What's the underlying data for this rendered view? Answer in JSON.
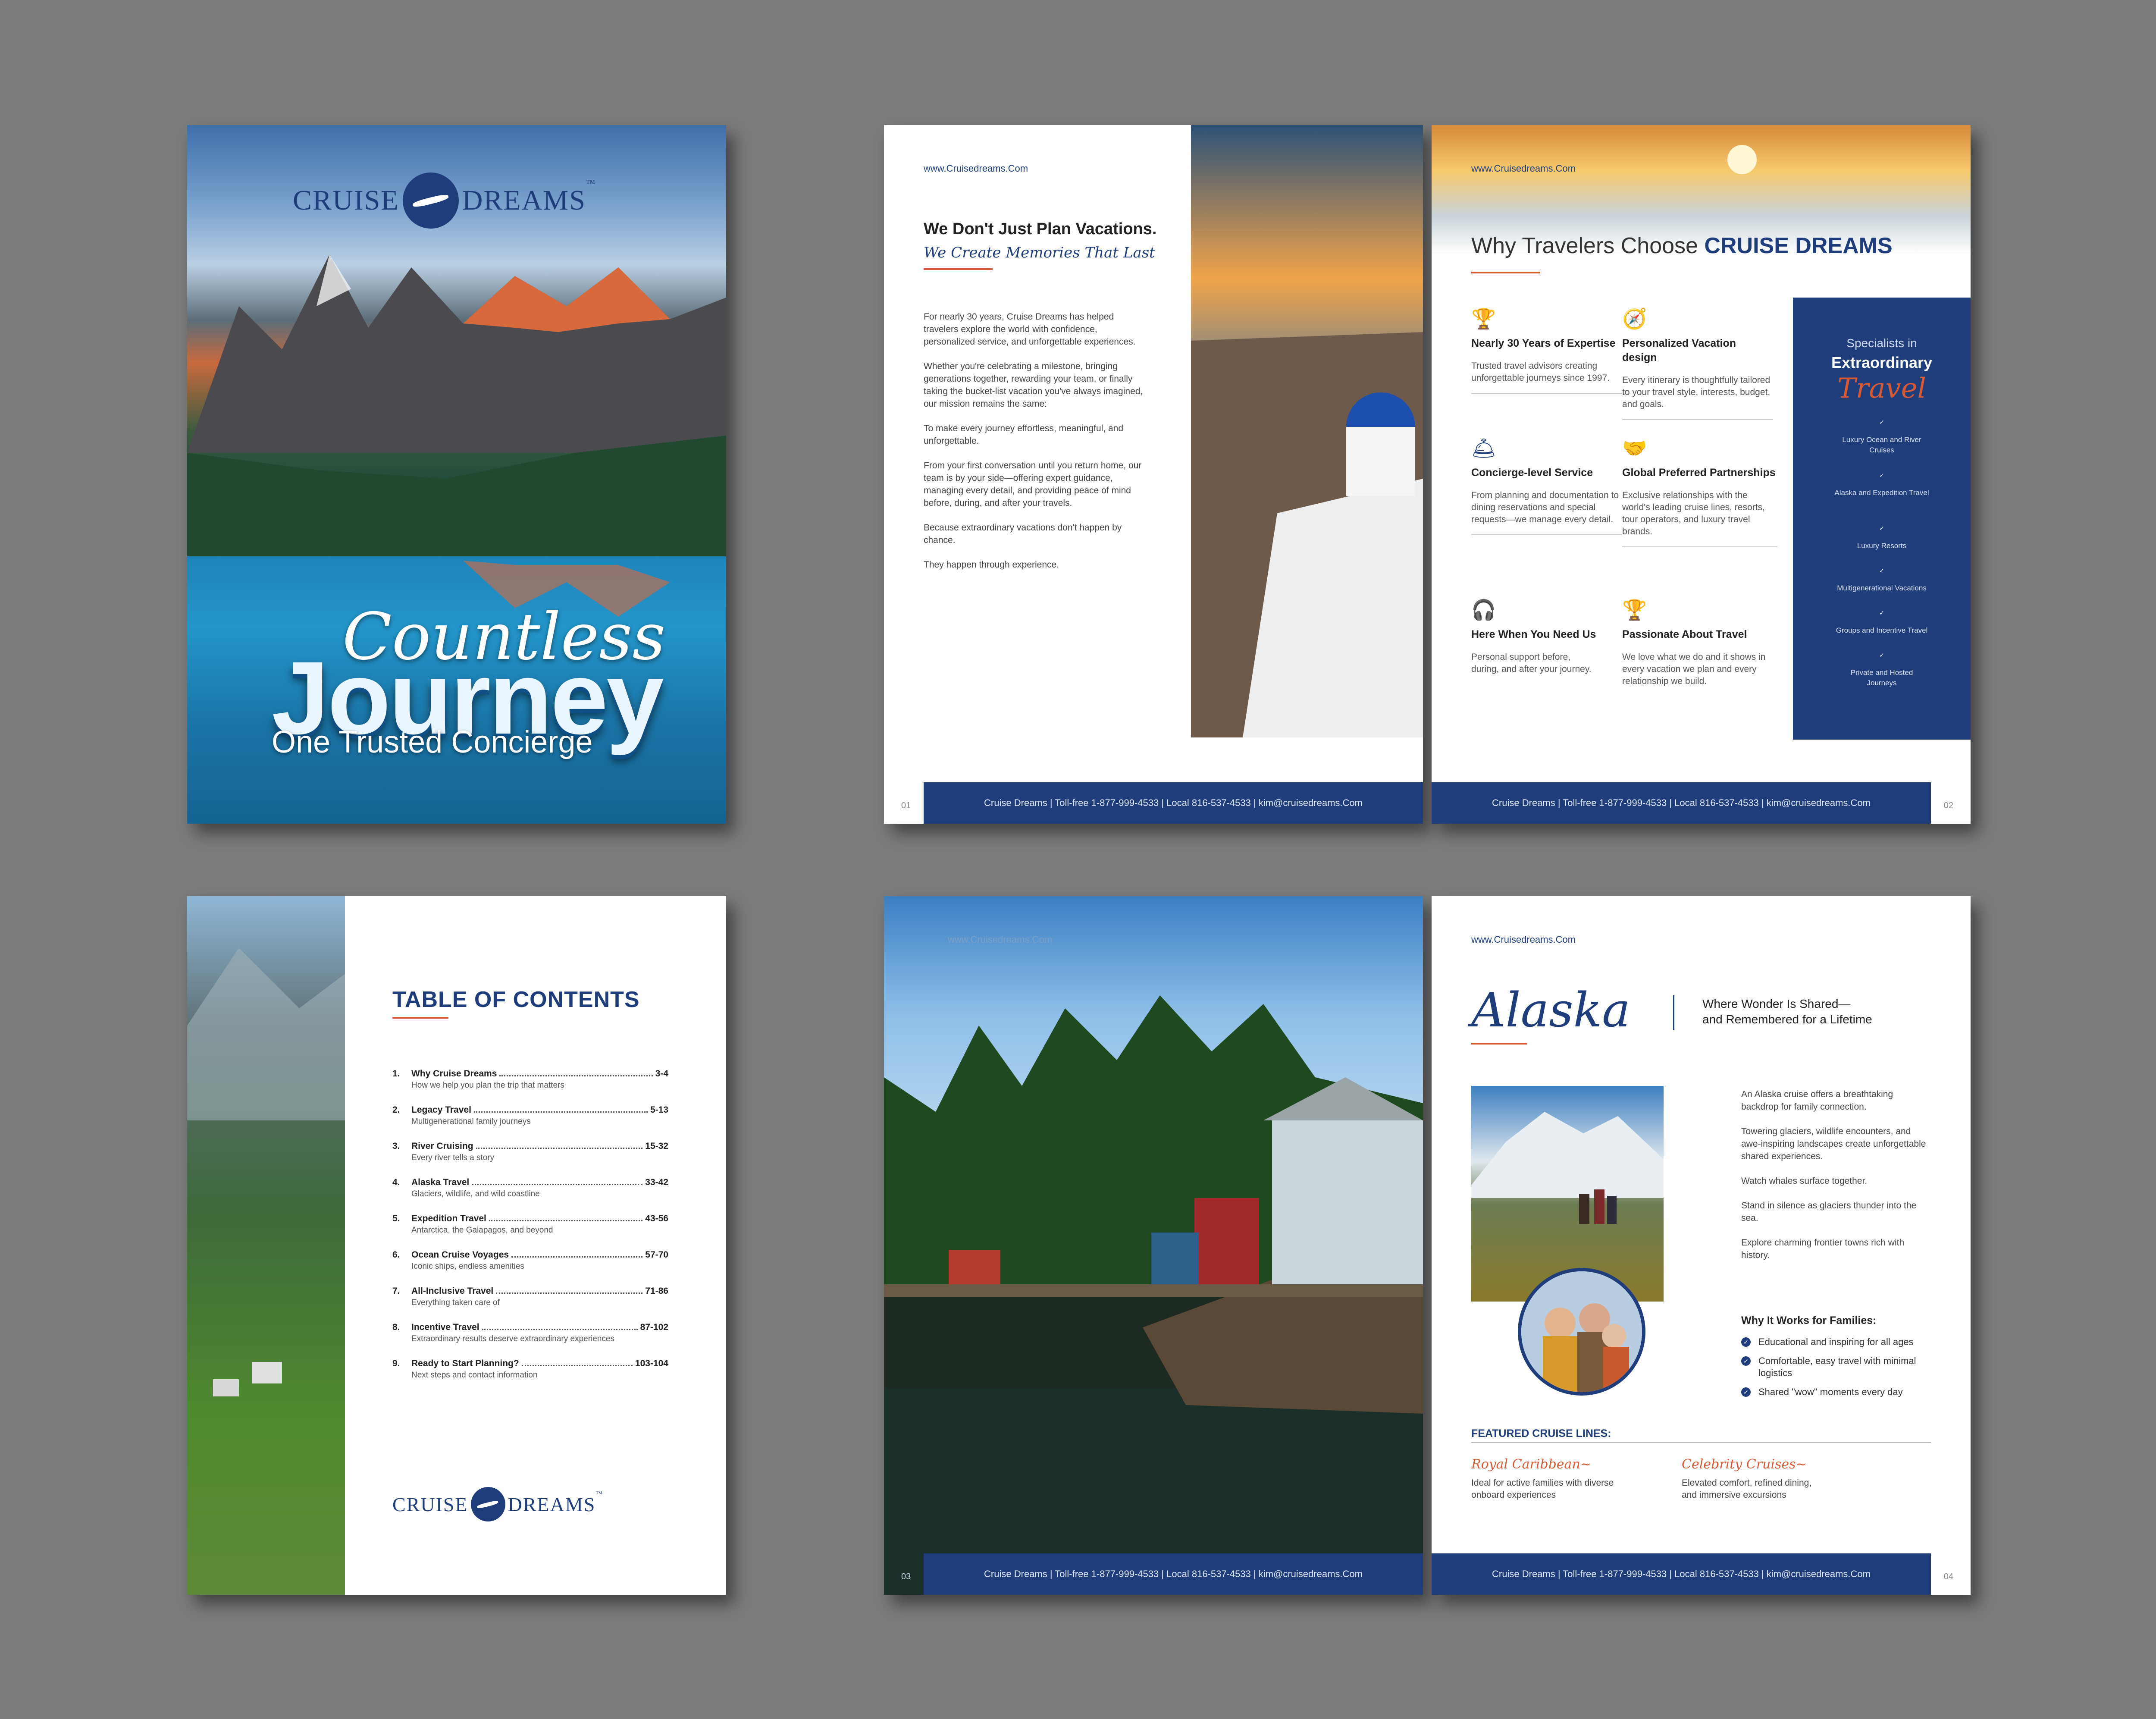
{
  "brand": {
    "name_left": "CRUISE",
    "name_right": "DREAMS",
    "tm": "™",
    "url": "www.Cruisedreams.Com"
  },
  "cover": {
    "script_title": "Countless",
    "title": "Journey",
    "subtitle": "One Trusted Concierge"
  },
  "footer_text": "Cruise Dreams | Toll-free 1-877-999-4533 | Local 816-537-4533 | kim@cruisedreams.Com",
  "page1": {
    "heading": "We Don't Just Plan Vacations.",
    "script_heading": "We Create Memories That Last",
    "paragraphs": [
      "For nearly 30 years, Cruise Dreams has helped travelers explore the world with confidence, personalized service, and unforgettable experiences.",
      "Whether you're celebrating a milestone, bringing generations together, rewarding your team, or finally taking the bucket-list vacation you've always imagined, our mission remains the same:",
      "To make every journey effortless, meaningful, and unforgettable.",
      "From your first conversation until you return home, our team is by your side—offering expert guidance, managing every detail, and providing peace of mind before, during, and after your travels.",
      "Because extraordinary vacations don't happen by chance.",
      "They happen through experience."
    ],
    "page_number": "01"
  },
  "page2": {
    "heading_plain": "Why Travelers Choose",
    "heading_bold": "CRUISE DREAMS",
    "features": [
      {
        "icon": "laurel-trophy-icon",
        "title": "Nearly 30 Years of Expertise",
        "desc": "Trusted travel advisors creating unforgettable journeys since 1997."
      },
      {
        "icon": "compass-icon",
        "title": "Personalized Vacation design",
        "desc": "Every itinerary is thoughtfully tailored to your travel style, interests, budget, and goals."
      },
      {
        "icon": "service-bell-icon",
        "title": "Concierge-level Service",
        "desc": "From planning and documentation to dining reservations and special requests—we manage every detail."
      },
      {
        "icon": "handshake-icon",
        "title": "Global Preferred Partnerships",
        "desc": "Exclusive relationships with the world's leading cruise lines, resorts, tour operators, and luxury travel brands."
      },
      {
        "icon": "headset-icon",
        "title": "Here When You Need Us",
        "desc": "Personal support before, during, and after your journey."
      },
      {
        "icon": "trophy-icon",
        "title": "Passionate About Travel",
        "desc": "We love what we do and it shows in every vacation we plan and every relationship we build."
      }
    ],
    "sidebar": {
      "line1": "Specialists in",
      "line2": "Extraordinary",
      "script": "Travel",
      "items": [
        "Luxury Ocean and River Cruises",
        "Alaska and Expedition Travel",
        "Luxury Resorts",
        "Multigenerational Vacations",
        "Groups and Incentive Travel",
        "Private and Hosted Journeys"
      ]
    },
    "page_number": "02"
  },
  "toc": {
    "title": "TABLE OF CONTENTS",
    "items": [
      {
        "num": "1.",
        "title": "Why Cruise Dreams",
        "pages": "3-4",
        "sub": "How we help you plan the trip that matters"
      },
      {
        "num": "2.",
        "title": "Legacy Travel",
        "pages": "5-13",
        "sub": "Multigenerational family journeys"
      },
      {
        "num": "3.",
        "title": "River Cruising",
        "pages": "15-32",
        "sub": "Every river tells a story"
      },
      {
        "num": "4.",
        "title": "Alaska Travel",
        "pages": "33-42",
        "sub": "Glaciers, wildlife, and wild coastline"
      },
      {
        "num": "5.",
        "title": "Expedition Travel",
        "pages": "43-56",
        "sub": "Antarctica, the Galapagos, and beyond"
      },
      {
        "num": "6.",
        "title": "Ocean Cruise Voyages",
        "pages": "57-70",
        "sub": "Iconic ships, endless amenities"
      },
      {
        "num": "7.",
        "title": "All-Inclusive Travel",
        "pages": "71-86",
        "sub": "Everything taken care of"
      },
      {
        "num": "8.",
        "title": "Incentive Travel",
        "pages": "87-102",
        "sub": "Extraordinary results deserve extraordinary experiences"
      },
      {
        "num": "9.",
        "title": "Ready to Start Planning?",
        "pages": "103-104",
        "sub": "Next steps and contact information"
      }
    ]
  },
  "page3": {
    "page_number": "03"
  },
  "page4": {
    "script_title": "Alaska",
    "tagline1": "Where Wonder Is Shared—",
    "tagline2": "and Remembered for a Lifetime",
    "paragraphs": [
      "An Alaska cruise offers a breathtaking backdrop for family connection.",
      "Towering glaciers, wildlife encounters, and awe-inspiring landscapes create unforgettable shared experiences.",
      "Watch whales surface together.",
      "Stand in silence as glaciers thunder into the sea.",
      "Explore charming frontier towns rich with history."
    ],
    "why_title": "Why It Works for Families:",
    "why_items": [
      "Educational and inspiring for all ages",
      "Comfortable, easy travel with minimal logistics",
      "Shared \"wow\" moments every day"
    ],
    "featured_title": "FEATURED CRUISE LINES:",
    "lines": [
      {
        "name": "Royal Caribbean~",
        "desc": "Ideal for active families with diverse onboard experiences"
      },
      {
        "name": "Celebrity Cruises~",
        "desc": "Elevated comfort, refined dining, and immersive excursions"
      }
    ],
    "page_number": "04"
  },
  "colors": {
    "navy": "#1f3d7a",
    "accent": "#d85a34",
    "background": "#7b7b7b"
  }
}
